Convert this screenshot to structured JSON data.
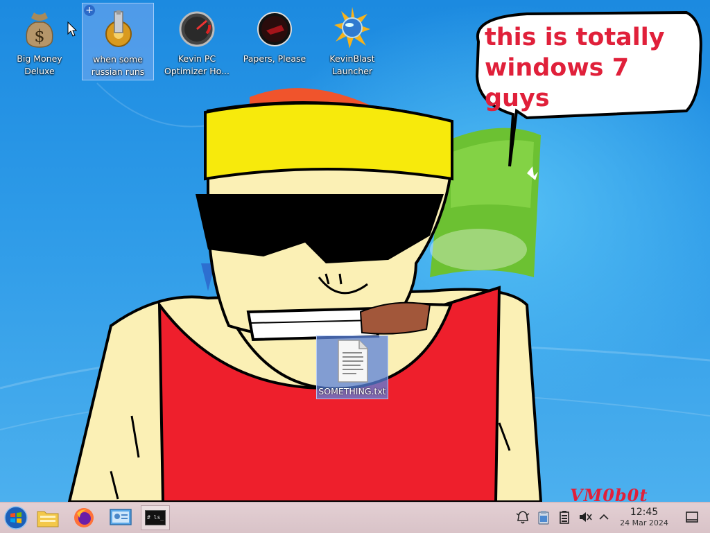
{
  "desktop": {
    "icons": [
      {
        "label": "Big Money\nDeluxe",
        "icon": "money-bag-icon"
      },
      {
        "label": "when some\nrussian runs a...",
        "icon": "gear-icon",
        "selected": true
      },
      {
        "label": "Kevin PC\nOptimizer Ho...",
        "icon": "speedometer-icon"
      },
      {
        "label": "Papers, Please",
        "icon": "papers-please-icon"
      },
      {
        "label": "KevinBlast\nLauncher",
        "icon": "blast-globe-icon"
      }
    ],
    "file": {
      "label": "SOMETHING.txt",
      "icon": "text-document-icon"
    },
    "speech_bubble": [
      "this is totally",
      "windows 7 guys"
    ],
    "signature": "VM0b0t"
  },
  "taskbar": {
    "start": "start-orb-icon",
    "pinned": [
      "file-manager-icon",
      "firefox-icon",
      "control-panel-icon",
      "terminal-icon"
    ],
    "terminal_label": "# ls_",
    "tray": [
      "notifications-icon",
      "clipboard-icon",
      "battery-icon",
      "volume-muted-icon",
      "chevron-up-icon"
    ],
    "clock": {
      "time": "12:45",
      "date": "24 Mar 2024"
    },
    "show_desktop": "show-desktop-icon"
  },
  "colors": {
    "accent_red": "#e0203a",
    "taskbar": "#e3cfd3"
  }
}
